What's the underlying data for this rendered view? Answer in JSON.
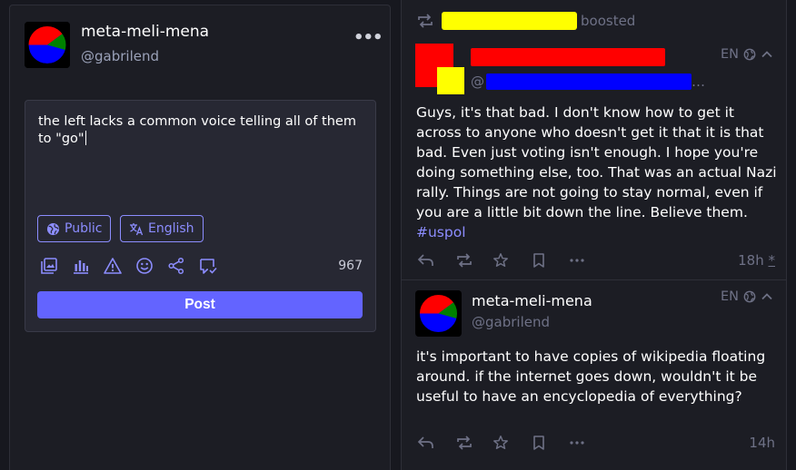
{
  "compose_panel": {
    "account": {
      "display_name": "meta-meli-mena",
      "handle": "@gabrilend",
      "more_icon": "ellipsis-icon",
      "more_label": "•••"
    },
    "text_value": "the left lacks a common voice telling all of them to \"go\"",
    "visibility_label": "Public",
    "language_label": "English",
    "tools": [
      "media-icon",
      "poll-icon",
      "content-warning-icon",
      "emoji-icon",
      "share-icon",
      "quote-icon"
    ],
    "char_count": "967",
    "post_label": "Post"
  },
  "timeline": {
    "status_1": {
      "boosted_label": "boosted",
      "handle_prefix": "@",
      "handle_suffix": "…",
      "language": "EN",
      "body": "Guys, it's that bad. I don't know how to get it across to anyone who doesn't get it that it is that bad. Even just voting isn't enough. I hope you're doing something else, too. That was an actual Nazi rally. Things are not going to stay normal, even if you are a little bit down the line. Believe them. ",
      "hashtag": "#uspol",
      "time": "18h",
      "edited_marker": "*"
    },
    "status_2": {
      "display_name": "meta-meli-mena",
      "handle": "@gabrilend",
      "language": "EN",
      "body": "it's important to have copies of wikipedia floating around. if the internet goes down, wouldn't it be useful to have an encyclopedia of everything?",
      "time": "14h"
    }
  },
  "colors": {
    "background": "#17181f",
    "panel": "#1c1d24",
    "accent": "#6364ff",
    "accent_text": "#8c8dff",
    "muted_text": "#6e7186",
    "redaction_red": "#ff0000",
    "redaction_yellow": "#ffff00",
    "redaction_blue": "#0000ff"
  }
}
